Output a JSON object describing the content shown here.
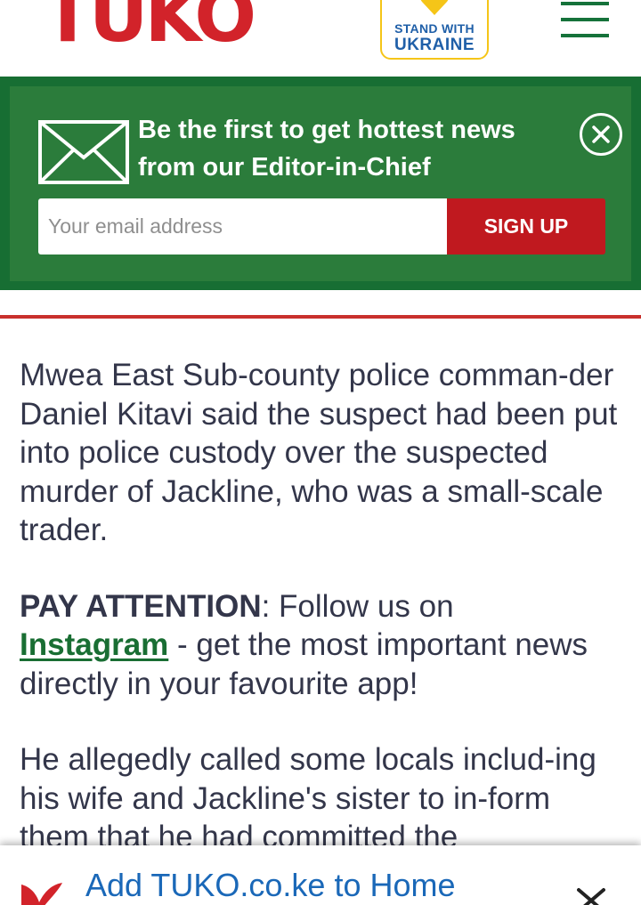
{
  "header": {
    "logo_text": "TUKO",
    "ukraine_badge": {
      "line1": "STAND WITH",
      "line2": "UKRAINE",
      "heart_color": "#f5c518",
      "text_color": "#1f5fa8"
    },
    "menu_icon": "hamburger-menu-icon"
  },
  "newsletter": {
    "title": "Be the first to get hottest news from our Editor-in-Chief",
    "email_placeholder": "Your email address",
    "email_value": "",
    "signup_label": "SIGN UP",
    "mail_icon": "envelope-icon",
    "close_icon": "close-circle-icon"
  },
  "article": {
    "para1": "Mwea East Sub-county police comman-der Daniel Kitavi said the suspect had been put into police custody over the suspected murder of Jackline, who was a small-scale trader.",
    "pay_attention_label": "PAY ATTENTION",
    "pay_attention_sep": ": Follow us on",
    "instagram_link": "Instagram",
    "pay_attention_rest": " - get the most important news directly in your favourite app!",
    "para3": "He allegedly called some locals includ-ing his wife and Jackline's sister to in-form them that he had committed the"
  },
  "add_to_home": {
    "text": "Add TUKO.co.ke to Home",
    "app_icon": "tuko-app-icon",
    "close_icon": "chevron-down-icon"
  },
  "colors": {
    "brand_red": "#d2232a",
    "brand_green": "#176e33",
    "signup_red": "#c0191f",
    "link_blue": "#1a68b8"
  }
}
